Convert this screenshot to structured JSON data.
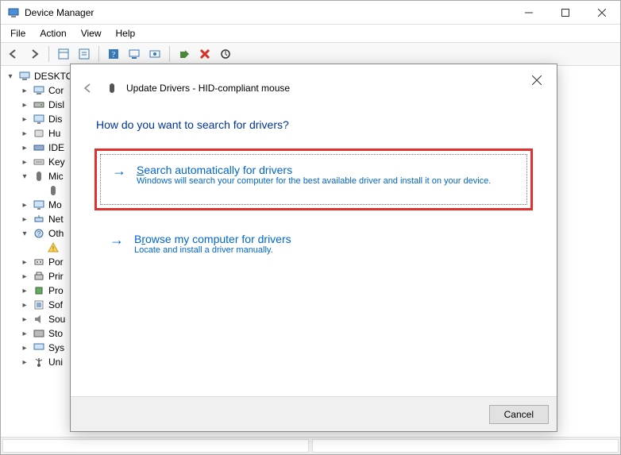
{
  "window": {
    "title": "Device Manager"
  },
  "menubar": {
    "items": [
      "File",
      "Action",
      "View",
      "Help"
    ]
  },
  "tree": {
    "root": "DESKTO",
    "nodes": [
      {
        "label": "Cor",
        "exp": "right",
        "icon": "computer"
      },
      {
        "label": "Disl",
        "exp": "right",
        "icon": "disk"
      },
      {
        "label": "Dis",
        "exp": "right",
        "icon": "monitor"
      },
      {
        "label": "Hu",
        "exp": "right",
        "icon": "hid"
      },
      {
        "label": "IDE",
        "exp": "right",
        "icon": "ide"
      },
      {
        "label": "Key",
        "exp": "right",
        "icon": "keyboard"
      },
      {
        "label": "Mic",
        "exp": "down",
        "icon": "mouse",
        "children": [
          {
            "label": "",
            "icon": "mouse"
          }
        ]
      },
      {
        "label": "Mo",
        "exp": "right",
        "icon": "monitor"
      },
      {
        "label": "Net",
        "exp": "right",
        "icon": "network"
      },
      {
        "label": "Oth",
        "exp": "down",
        "icon": "other",
        "children": [
          {
            "label": "",
            "icon": "warn"
          }
        ]
      },
      {
        "label": "Por",
        "exp": "right",
        "icon": "port"
      },
      {
        "label": "Prir",
        "exp": "right",
        "icon": "printer"
      },
      {
        "label": "Pro",
        "exp": "right",
        "icon": "processor"
      },
      {
        "label": "Sof",
        "exp": "right",
        "icon": "software"
      },
      {
        "label": "Sou",
        "exp": "right",
        "icon": "sound"
      },
      {
        "label": "Sto",
        "exp": "right",
        "icon": "storage"
      },
      {
        "label": "Sys",
        "exp": "right",
        "icon": "system"
      },
      {
        "label": "Uni",
        "exp": "right",
        "icon": "usb"
      }
    ]
  },
  "dialog": {
    "title": "Update Drivers - HID-compliant mouse",
    "heading": "How do you want to search for drivers?",
    "options": [
      {
        "title_pre": "S",
        "title_rest": "earch automatically for drivers",
        "desc": "Windows will search your computer for the best available driver and install it on your device.",
        "highlight": true
      },
      {
        "title_pre": "B",
        "title_mid": "r",
        "title_rest": "owse my computer for drivers",
        "desc": "Locate and install a driver manually.",
        "highlight": false
      }
    ],
    "cancel": "Cancel"
  }
}
